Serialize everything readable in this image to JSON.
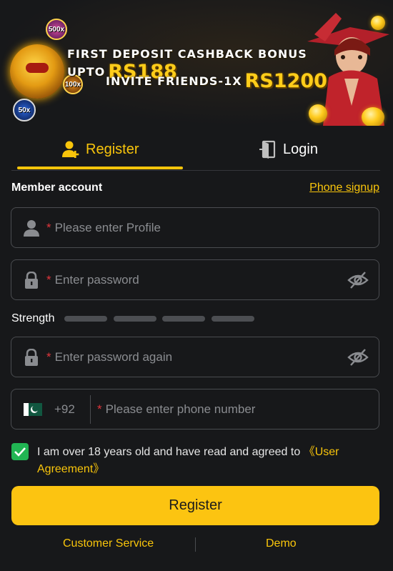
{
  "banner": {
    "line1_text": "FIRST DEPOSIT CASHBACK BONUS UPTO",
    "line1_amount": "RS188",
    "line2_text": "INVITE FRIENDS-1X",
    "line2_amount": "RS1200",
    "chips": [
      "500x",
      "100x",
      "50x"
    ]
  },
  "tabs": [
    {
      "label": "Register",
      "icon": "add-user-icon",
      "active": true
    },
    {
      "label": "Login",
      "icon": "login-door-icon",
      "active": false
    }
  ],
  "form": {
    "section_title": "Member account",
    "phone_signup_link": "Phone signup",
    "required_mark": "*",
    "profile_placeholder": "Please enter Profile",
    "password_placeholder": "Enter password",
    "strength_label": "Strength",
    "strength_segments": 4,
    "password_again_placeholder": "Enter password again",
    "country_flag": "pakistan-flag-icon",
    "dial_code": "+92",
    "phone_placeholder": "Please enter phone number"
  },
  "agreement": {
    "checked": true,
    "text": "I am over 18 years old and have read and agreed to ",
    "link": "《User Agreement》"
  },
  "register_button": "Register",
  "footer": {
    "customer_service": "Customer Service",
    "demo": "Demo"
  },
  "colors": {
    "accent": "#f9c50b",
    "button": "#fcc411",
    "background": "#17181a",
    "check": "#21b553",
    "required": "#e0353b"
  }
}
